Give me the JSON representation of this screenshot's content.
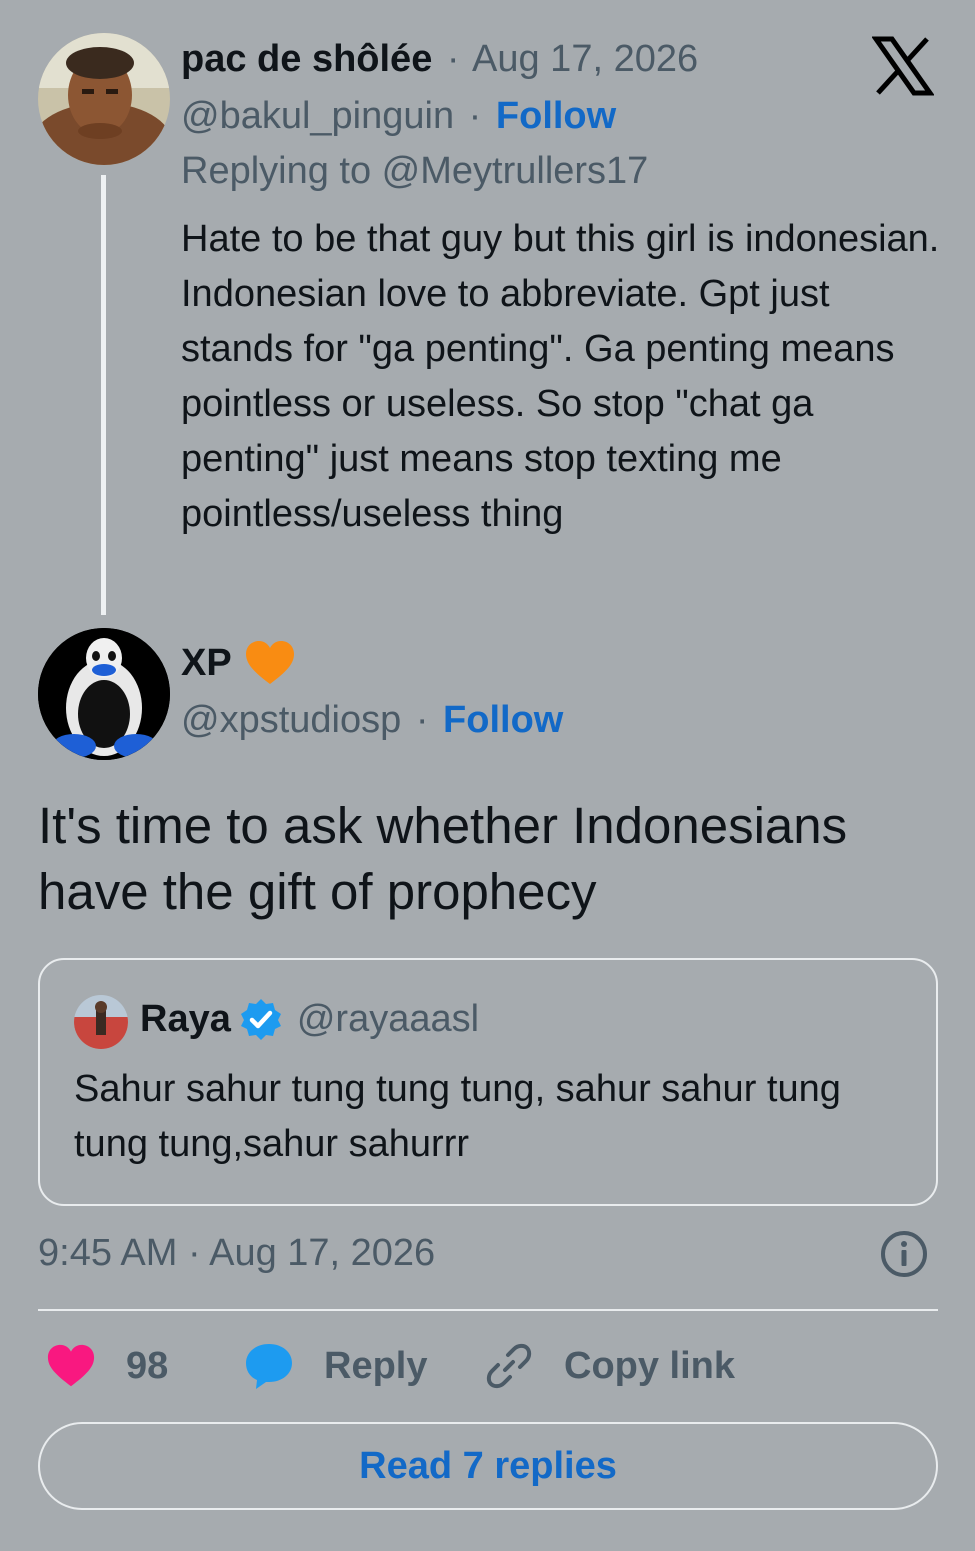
{
  "reply_tweet": {
    "name": "pac de shôlée",
    "date_sep": "·",
    "date": "Aug 17, 2026",
    "handle": "@bakul_pinguin",
    "follow_sep": "·",
    "follow": "Follow",
    "replying_to": "Replying to @Meytrullers17",
    "text": "Hate to be that guy but this girl is indonesian. Indonesian love to abbreviate. Gpt just stands for \"ga penting\". Ga penting means pointless or useless. So stop \"chat ga penting\" just means stop texting me pointless/useless thing"
  },
  "main_tweet": {
    "name": "XP",
    "badge_icon": "orange-heart",
    "handle": "@xpstudiosp",
    "follow_sep": "·",
    "follow": "Follow",
    "text": "It's time to ask whether Indonesians have the gift of prophecy",
    "timestamp": "9:45 AM · Aug 17, 2026"
  },
  "quoted_tweet": {
    "name": "Raya",
    "handle": "@rayaaasl",
    "verified_icon": "verified-badge",
    "text": "Sahur sahur tung tung tung, sahur sahur tung tung tung,sahur sahurrr"
  },
  "actions": {
    "likes_count": "98",
    "reply_label": "Reply",
    "copy_link_label": "Copy link"
  },
  "read_replies": "Read 7 replies",
  "colors": {
    "background": "#a6abaf",
    "link_blue": "#1269c7",
    "heart_pink": "#f91880",
    "reply_blue": "#1d9bf0",
    "badge_orange": "#f98c12"
  }
}
